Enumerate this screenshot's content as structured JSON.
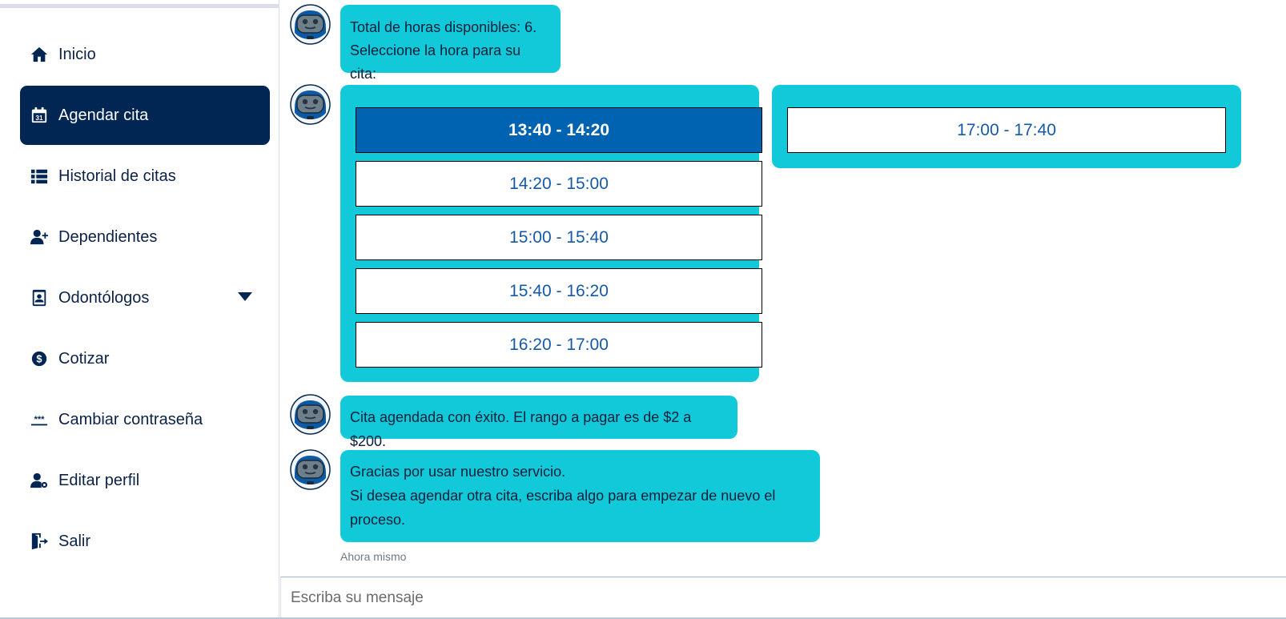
{
  "sidebar": {
    "items": [
      {
        "label": "Inicio",
        "icon": "home-icon"
      },
      {
        "label": "Agendar cita",
        "icon": "calendar-icon",
        "calendar_day": "31"
      },
      {
        "label": "Historial de citas",
        "icon": "list-icon"
      },
      {
        "label": "Dependientes",
        "icon": "user-plus-icon"
      },
      {
        "label": "Odontólogos",
        "icon": "id-badge-icon"
      },
      {
        "label": "Cotizar",
        "icon": "dollar-circle-icon"
      },
      {
        "label": "Cambiar contraseña",
        "icon": "password-icon",
        "glyph": "***"
      },
      {
        "label": "Editar perfil",
        "icon": "user-gear-icon"
      },
      {
        "label": "Salir",
        "icon": "exit-door-icon"
      }
    ]
  },
  "chat": {
    "messages": {
      "available_line1": "Total de horas disponibles: 6.",
      "available_line2": "Seleccione la hora para su cita:",
      "success": "Cita agendada con éxito. El rango a pagar es de $2 a $200.",
      "thanks_line1": "Gracias por usar nuestro servicio.",
      "thanks_line2": "Si desea agendar otra cita, escriba algo para empezar de nuevo el",
      "thanks_line3": "proceso."
    },
    "slots": [
      {
        "label": "13:40 - 14:20",
        "selected": true
      },
      {
        "label": "14:20 - 15:00",
        "selected": false
      },
      {
        "label": "15:00 - 15:40",
        "selected": false
      },
      {
        "label": "15:40 - 16:20",
        "selected": false
      },
      {
        "label": "16:20 - 17:00",
        "selected": false
      },
      {
        "label": "17:00 - 17:40",
        "selected": false
      }
    ],
    "timestamp": "Ahora mismo"
  },
  "composer": {
    "placeholder": "Escriba su mensaje"
  },
  "colors": {
    "sidebar_active": "#022654",
    "bubble": "#12c9d9",
    "slot_selected": "#0063b1",
    "slot_text": "#1559a8"
  }
}
